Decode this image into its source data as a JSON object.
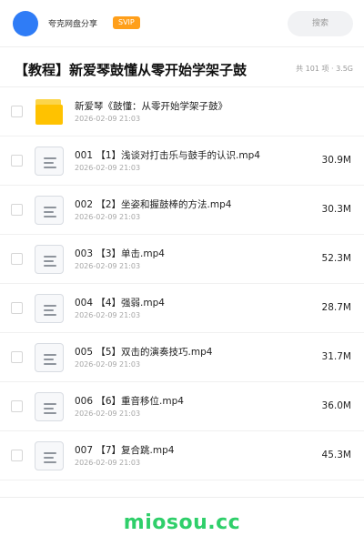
{
  "header": {
    "user_name": "夸克网盘分享",
    "badge": "SVIP",
    "search_placeholder": "搜索"
  },
  "folder": {
    "title": "【教程】新爱琴鼓懂从零开始学架子鼓",
    "meta": "共 101 项 · 3.5G"
  },
  "items": [
    {
      "type": "folder",
      "name": "新爱琴《鼓懂：从零开始学架子鼓》",
      "date": "2026-02-09 21:03",
      "size": ""
    },
    {
      "type": "file",
      "name": "001 【1】浅谈对打击乐与鼓手的认识.mp4",
      "date": "2026-02-09 21:03",
      "size": "30.9M"
    },
    {
      "type": "file",
      "name": "002 【2】坐姿和握鼓棒的方法.mp4",
      "date": "2026-02-09 21:03",
      "size": "30.3M"
    },
    {
      "type": "file",
      "name": "003 【3】单击.mp4",
      "date": "2026-02-09 21:03",
      "size": "52.3M"
    },
    {
      "type": "file",
      "name": "004 【4】强弱.mp4",
      "date": "2026-02-09 21:03",
      "size": "28.7M"
    },
    {
      "type": "file",
      "name": "005 【5】双击的演奏技巧.mp4",
      "date": "2026-02-09 21:03",
      "size": "31.7M"
    },
    {
      "type": "file",
      "name": "006 【6】重音移位.mp4",
      "date": "2026-02-09 21:03",
      "size": "36.0M"
    },
    {
      "type": "file",
      "name": "007 【7】复合跳.mp4",
      "date": "2026-02-09 21:03",
      "size": "45.3M"
    }
  ],
  "footer": {
    "watermark": "miosou.cc"
  },
  "colors": {
    "avatar": "#2f7cf6",
    "badge": "#ff9f1a",
    "folder_icon": "#ffc200",
    "watermark": "#2fcf6a"
  }
}
